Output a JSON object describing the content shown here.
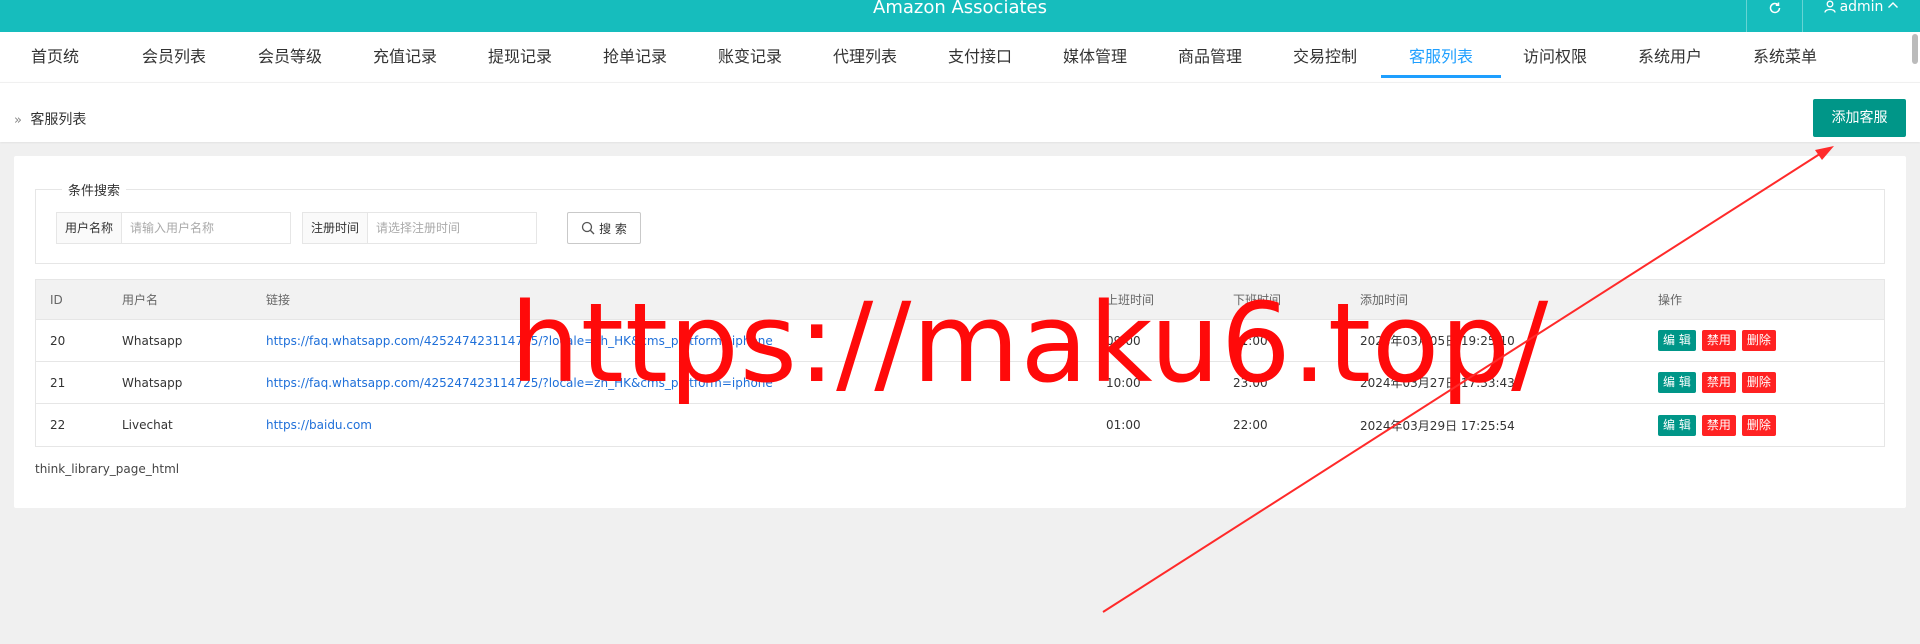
{
  "header": {
    "title": "Amazon Associates",
    "refresh_icon": "refresh-icon",
    "user_icon": "user-icon",
    "user_name": "admin",
    "user_caret": "^",
    "colors": {
      "bar": "#16bdbd"
    }
  },
  "nav": {
    "active": "客服列表",
    "items": [
      "首页统计",
      "会员列表",
      "会员等级",
      "充值记录",
      "提现记录",
      "抢单记录",
      "账变记录",
      "代理列表",
      "支付接口",
      "媒体管理",
      "商品管理",
      "交易控制",
      "客服列表",
      "访问权限",
      "系统用户",
      "系统菜单"
    ]
  },
  "breadcrumb": {
    "text": "客服列表"
  },
  "toolbar": {
    "add_label": "添加客服"
  },
  "search": {
    "legend": "条件搜索",
    "username_label": "用户名称",
    "username_placeholder": "请输入用户名称",
    "regtime_label": "注册时间",
    "regtime_placeholder": "请选择注册时间",
    "button_label": "搜 索"
  },
  "table": {
    "headers": {
      "id": "ID",
      "username": "用户名",
      "link": "链接",
      "start": "上班时间",
      "end": "下班时间",
      "added": "添加时间",
      "ops": "操作"
    },
    "rows": [
      {
        "id": "20",
        "username": "Whatsapp",
        "link": "https://faq.whatsapp.com/425247423114725/?locale=zh_HK&cms_platform=iphone",
        "start": "09:00",
        "end": "21:00",
        "added": "2023年03月05日 19:25:10"
      },
      {
        "id": "21",
        "username": "Whatsapp",
        "link": "https://faq.whatsapp.com/425247423114725/?locale=zh_HK&cms_platform=iphone",
        "start": "10:00",
        "end": "23:00",
        "added": "2024年03月27日 17:33:43"
      },
      {
        "id": "22",
        "username": "Livechat",
        "link": "https://baidu.com",
        "start": "01:00",
        "end": "22:00",
        "added": "2024年03月29日 17:25:54"
      }
    ],
    "op_labels": {
      "edit": "编 辑",
      "disable": "禁用",
      "delete": "删除"
    },
    "colors": {
      "edit": "#009688",
      "danger": "#ff2222"
    }
  },
  "footer": {
    "text": "think_library_page_html"
  },
  "overlay": {
    "watermark": "https://maku6.top/",
    "color": "#ff0a0a"
  }
}
